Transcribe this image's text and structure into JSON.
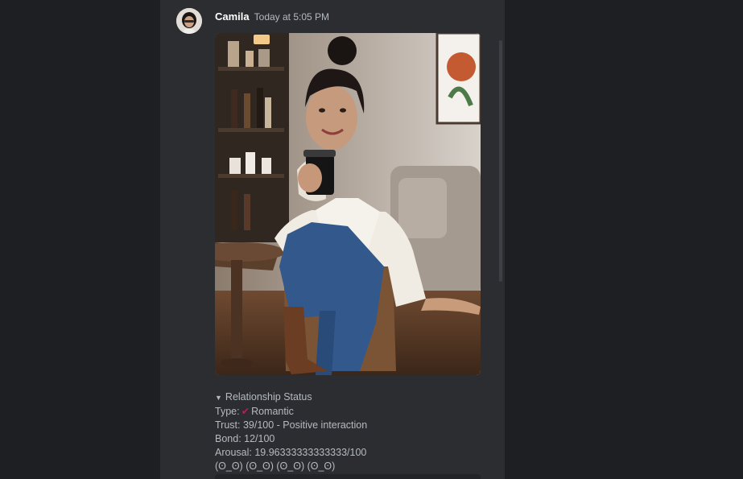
{
  "message": {
    "author": "Camila",
    "timestamp": "Today at 5:05 PM"
  },
  "relationship": {
    "summary": "Relationship Status",
    "type_label": "Type:",
    "type_value": "Romantic",
    "trust": "Trust: 39/100 - Positive interaction",
    "bond": "Bond: 12/100",
    "arousal": "Arousal: 19.96333333333333/100",
    "emotes": "(ʘ_ʘ) (ʘ_ʘ) (ʘ_ʘ) (ʘ_ʘ)"
  },
  "colors": {
    "background": "#1e1f22",
    "panel": "#2b2d31",
    "text_muted": "#b5bac1",
    "author": "#ffffff",
    "accent": "#c2185b"
  }
}
